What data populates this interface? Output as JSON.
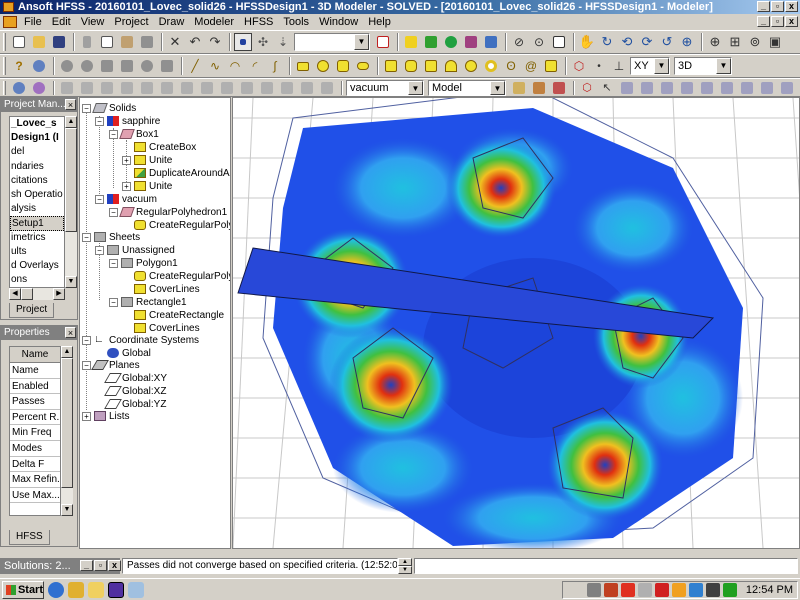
{
  "window": {
    "title": "Ansoft HFSS - 20160101_Lovec_solid26 - HFSSDesign1 - 3D Modeler - SOLVED - [20160101_Lovec_solid26 - HFSSDesign1 - Modeler]",
    "min": "_",
    "max": "▫",
    "close": "x"
  },
  "menu": [
    "File",
    "Edit",
    "View",
    "Project",
    "Draw",
    "Modeler",
    "HFSS",
    "Tools",
    "Window",
    "Help"
  ],
  "toolbar": {
    "material_combo": "vacuum",
    "model_combo": "Model",
    "plane_combo": "XY",
    "dim_combo": "3D"
  },
  "project_manager": {
    "title": "Project Man...",
    "items": [
      "_Lovec_s",
      "Design1 (I",
      "del",
      "ndaries",
      "citations",
      "sh Operatio",
      "alysis",
      "Setup1",
      "imetrics",
      "ults",
      "d Overlays",
      "ons"
    ],
    "tab": "Project"
  },
  "properties": {
    "title": "Properties",
    "header": "Name",
    "rows": [
      "Name",
      "Enabled",
      "Passes",
      "Percent R...",
      "Min Freq",
      "Modes",
      "Delta F",
      "Max Refin...",
      "Use Max..."
    ],
    "tab": "HFSS"
  },
  "tree": {
    "solids": "Solids",
    "sapphire": "sapphire",
    "box1": "Box1",
    "create_box": "CreateBox",
    "unite1": "Unite",
    "duplicate": "DuplicateAroundAxi",
    "unite2": "Unite",
    "vacuum": "vacuum",
    "polyhedron": "RegularPolyhedron1",
    "create_polyhedron": "CreateRegularPolyh",
    "sheets": "Sheets",
    "unassigned": "Unassigned",
    "polygon1": "Polygon1",
    "create_polygon": "CreateRegularPolyg",
    "coverlines1": "CoverLines",
    "rectangle1": "Rectangle1",
    "create_rect": "CreateRectangle",
    "coverlines2": "CoverLines",
    "coord_systems": "Coordinate Systems",
    "global": "Global",
    "planes": "Planes",
    "plane_xy": "Global:XY",
    "plane_xz": "Global:XZ",
    "plane_yz": "Global:YZ",
    "lists": "Lists"
  },
  "status": {
    "solutions": "Solutions: 2...",
    "message": "Passes did not converge based on specified criteria. (12:52:01 PM"
  },
  "taskbar": {
    "start": "Start",
    "clock": "12:54 PM"
  }
}
